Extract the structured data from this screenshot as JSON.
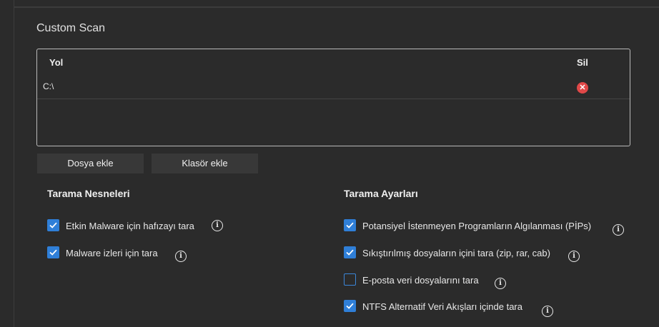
{
  "page": {
    "title": "Custom Scan"
  },
  "table": {
    "col_path": "Yol",
    "col_delete": "Sil",
    "rows": [
      {
        "path": "C:\\"
      }
    ]
  },
  "buttons": {
    "add_file": "Dosya ekle",
    "add_folder": "Klasör ekle"
  },
  "scan_objects": {
    "title": "Tarama Nesneleri",
    "options": [
      {
        "label": "Etkin Malware için hafızayı tara",
        "checked": true
      },
      {
        "label": "Malware izleri için tara",
        "checked": true
      }
    ]
  },
  "scan_settings": {
    "title": "Tarama Ayarları",
    "options": [
      {
        "label": "Potansiyel İstenmeyen Programların Algılanması (PİPs)",
        "checked": true
      },
      {
        "label": "Sıkıştırılmış dosyaların içini tara (zip, rar, cab)",
        "checked": true
      },
      {
        "label": "E-posta veri dosyalarını tara",
        "checked": false
      },
      {
        "label": "NTFS Alternatif Veri Akışları içinde tara",
        "checked": true
      }
    ]
  },
  "colors": {
    "accent": "#2f7fd8",
    "delete": "#e04848",
    "background": "#2b2b2b"
  }
}
